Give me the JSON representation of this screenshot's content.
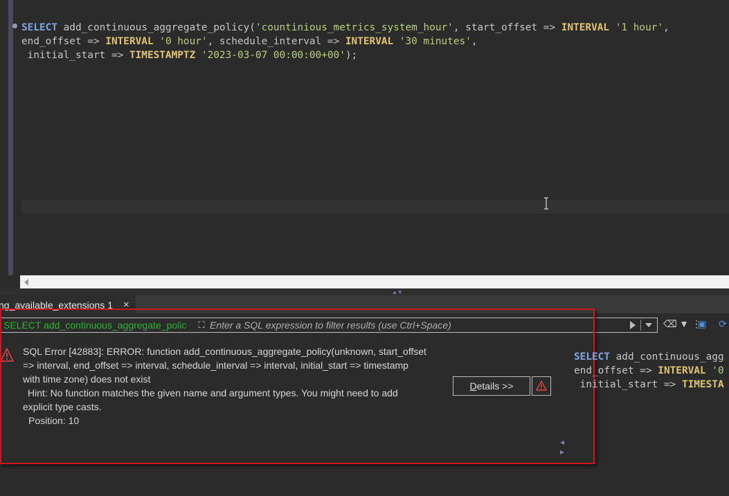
{
  "editor": {
    "code_lines": [
      [
        {
          "t": "SELECT",
          "c": "kw-select"
        },
        {
          "t": " add_continuous_aggregate_policy(",
          "c": ""
        },
        {
          "t": "'countinious_metrics_system_hour'",
          "c": "str"
        },
        {
          "t": ", start_offset => ",
          "c": ""
        },
        {
          "t": "INTERVAL",
          "c": "kw"
        },
        {
          "t": " ",
          "c": ""
        },
        {
          "t": "'1 hour'",
          "c": "str"
        },
        {
          "t": ",",
          "c": ""
        }
      ],
      [
        {
          "t": "end_offset => ",
          "c": ""
        },
        {
          "t": "INTERVAL",
          "c": "kw"
        },
        {
          "t": " ",
          "c": ""
        },
        {
          "t": "'0 hour'",
          "c": "str"
        },
        {
          "t": ", schedule_interval => ",
          "c": ""
        },
        {
          "t": "INTERVAL",
          "c": "kw"
        },
        {
          "t": " ",
          "c": ""
        },
        {
          "t": "'30 minutes'",
          "c": "str"
        },
        {
          "t": ",",
          "c": ""
        }
      ],
      [
        {
          "t": " initial_start => ",
          "c": ""
        },
        {
          "t": "TIMESTAMPTZ",
          "c": "kw"
        },
        {
          "t": " ",
          "c": ""
        },
        {
          "t": "'2023-03-07 00:00:00+00'",
          "c": "str"
        },
        {
          "t": ");",
          "c": ""
        }
      ]
    ]
  },
  "results": {
    "tab_label": "ng_available_extensions 1",
    "tab_close_glyph": "×",
    "filter": {
      "query_text": "SELECT add_continuous_aggregate_polic",
      "placeholder": "Enter a SQL expression to filter results (use Ctrl+Space)",
      "expand_glyph": "⛶"
    },
    "toolbar": {
      "icons": [
        {
          "name": "eraser-icon",
          "glyph": "⌫",
          "color": "#c8c8c8"
        },
        {
          "name": "filter-icon",
          "glyph": "▼",
          "color": "#c8c8c8"
        },
        {
          "name": "more-icon",
          "glyph": "⋮",
          "color": "#c8c8c8"
        },
        {
          "name": "panels-icon",
          "glyph": "▣",
          "color": "#4a8fd8"
        },
        {
          "name": "refresh-icon",
          "glyph": "⟳",
          "color": "#4a8fd8"
        }
      ]
    },
    "error": {
      "lines": [
        "SQL Error [42883]: ERROR: function add_continuous_aggregate_policy(unknown, start_offset",
        "=> interval, end_offset => interval, schedule_interval => interval, initial_start => timestamp",
        "with time zone) does not exist"
      ],
      "hint_lines": [
        "Hint: No function matches the given name and argument types. You might need to add",
        "explicit type casts."
      ],
      "position": "Position: 10",
      "details_accel": "D",
      "details_rest": "etails >>"
    },
    "side_preview_lines": [
      [
        {
          "t": "SELECT",
          "c": "kw-select"
        },
        {
          "t": " add_continuous_agg",
          "c": ""
        }
      ],
      [
        {
          "t": "end_offset => ",
          "c": ""
        },
        {
          "t": "INTERVAL",
          "c": "kw"
        },
        {
          "t": " ",
          "c": ""
        },
        {
          "t": "'0",
          "c": "str"
        }
      ],
      [
        {
          "t": " initial_start => ",
          "c": ""
        },
        {
          "t": "TIMESTA",
          "c": "kw"
        }
      ]
    ]
  },
  "colors": {
    "background": "#2b2b2b",
    "keyword_select": "#7ea7e6",
    "keyword": "#e1c472",
    "string": "#b8d27a",
    "error_border": "#d4141c",
    "filter_query": "#29b42f"
  }
}
